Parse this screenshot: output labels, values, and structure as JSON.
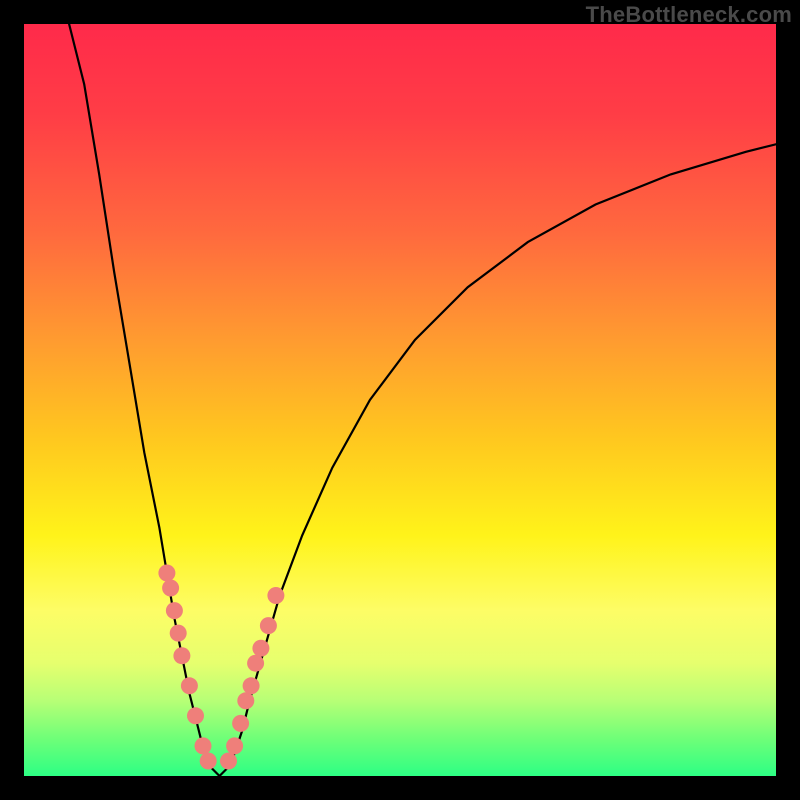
{
  "watermark": "TheBottleneck.com",
  "colors": {
    "frame_border": "#000000",
    "curve_stroke": "#000000",
    "marker_fill": "#ef7f7a",
    "marker_stroke": "#c45a56",
    "gradient_stops": [
      "#ff2a4a",
      "#ff3d46",
      "#ff6a3e",
      "#ff9b30",
      "#ffc71f",
      "#fff31a",
      "#fdfd66",
      "#e6ff6e",
      "#b7ff76",
      "#6fff78",
      "#2dff84"
    ]
  },
  "chart_data": {
    "type": "line",
    "title": "",
    "xlabel": "",
    "ylabel": "",
    "xlim": [
      0,
      100
    ],
    "ylim": [
      0,
      100
    ],
    "grid": false,
    "legend": false,
    "note": "Values are approximate, read from pixel positions; y measured as height above chart bottom (0 at bottom, 100 at top).",
    "series": [
      {
        "name": "bottleneck-curve",
        "style": "line",
        "points": [
          {
            "x": 6,
            "y": 100
          },
          {
            "x": 8,
            "y": 92
          },
          {
            "x": 10,
            "y": 80
          },
          {
            "x": 12,
            "y": 67
          },
          {
            "x": 14,
            "y": 55
          },
          {
            "x": 16,
            "y": 43
          },
          {
            "x": 18,
            "y": 33
          },
          {
            "x": 19,
            "y": 27
          },
          {
            "x": 20,
            "y": 21
          },
          {
            "x": 21,
            "y": 16
          },
          {
            "x": 22,
            "y": 11
          },
          {
            "x": 23,
            "y": 7
          },
          {
            "x": 24,
            "y": 3
          },
          {
            "x": 25,
            "y": 1
          },
          {
            "x": 26,
            "y": 0
          },
          {
            "x": 27,
            "y": 1
          },
          {
            "x": 28,
            "y": 3
          },
          {
            "x": 29,
            "y": 6
          },
          {
            "x": 30,
            "y": 10
          },
          {
            "x": 32,
            "y": 17
          },
          {
            "x": 34,
            "y": 24
          },
          {
            "x": 37,
            "y": 32
          },
          {
            "x": 41,
            "y": 41
          },
          {
            "x": 46,
            "y": 50
          },
          {
            "x": 52,
            "y": 58
          },
          {
            "x": 59,
            "y": 65
          },
          {
            "x": 67,
            "y": 71
          },
          {
            "x": 76,
            "y": 76
          },
          {
            "x": 86,
            "y": 80
          },
          {
            "x": 96,
            "y": 83
          },
          {
            "x": 100,
            "y": 84
          }
        ]
      },
      {
        "name": "markers-left-flank",
        "style": "scatter",
        "points": [
          {
            "x": 19.0,
            "y": 27
          },
          {
            "x": 19.5,
            "y": 25
          },
          {
            "x": 20.0,
            "y": 22
          },
          {
            "x": 20.5,
            "y": 19
          },
          {
            "x": 21.0,
            "y": 16
          },
          {
            "x": 22.0,
            "y": 12
          },
          {
            "x": 22.8,
            "y": 8
          },
          {
            "x": 23.8,
            "y": 4
          },
          {
            "x": 24.5,
            "y": 2
          }
        ]
      },
      {
        "name": "markers-right-flank",
        "style": "scatter",
        "points": [
          {
            "x": 27.2,
            "y": 2
          },
          {
            "x": 28.0,
            "y": 4
          },
          {
            "x": 28.8,
            "y": 7
          },
          {
            "x": 29.5,
            "y": 10
          },
          {
            "x": 30.2,
            "y": 12
          },
          {
            "x": 30.8,
            "y": 15
          },
          {
            "x": 31.5,
            "y": 17
          },
          {
            "x": 32.5,
            "y": 20
          },
          {
            "x": 33.5,
            "y": 24
          }
        ]
      }
    ]
  }
}
